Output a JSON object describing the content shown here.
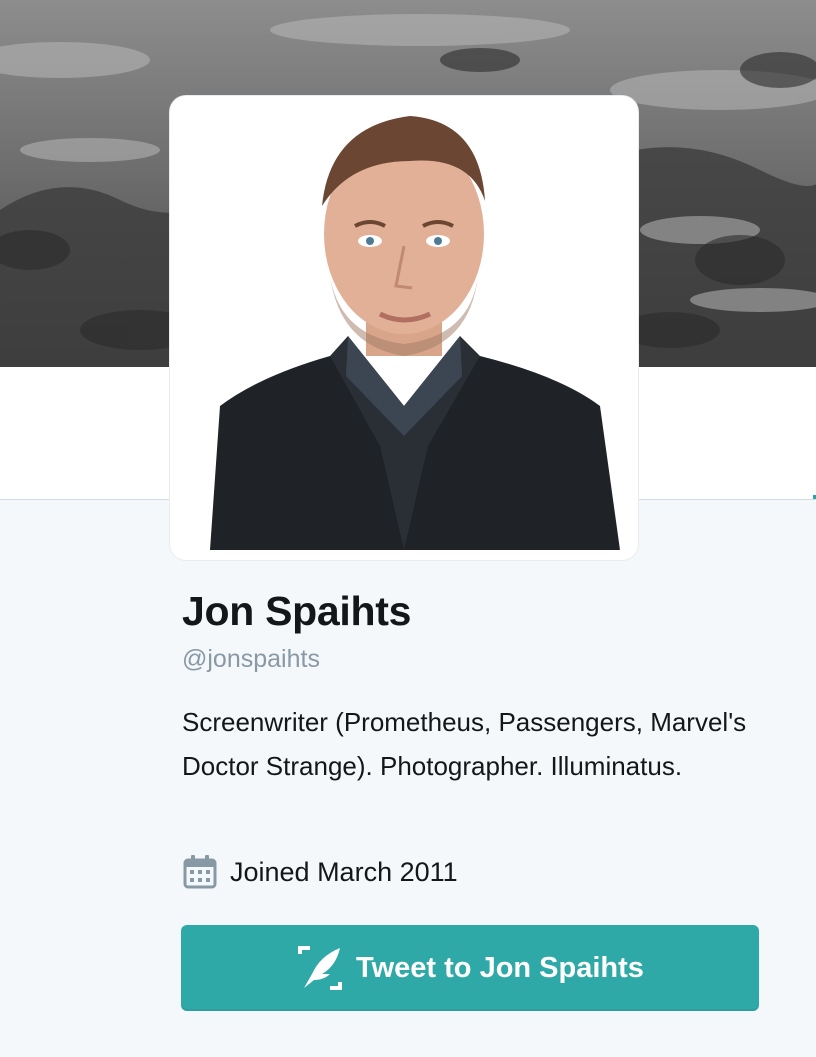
{
  "profile": {
    "name": "Jon Spaihts",
    "handle": "@jonspaihts",
    "bio": "Screenwriter (Prometheus, Passengers, Marvel's Doctor Strange). Photographer. Illuminatus.",
    "joined": "Joined March 2011"
  },
  "actions": {
    "tweet_to_label": "Tweet to Jon Spaihts"
  },
  "icons": {
    "calendar": "calendar-icon",
    "compose": "compose-quill-icon"
  },
  "colors": {
    "accent": "#2fa9a7",
    "page_background": "#f5f8fa",
    "handle_text": "#8899a6",
    "primary_text": "#14171a"
  }
}
